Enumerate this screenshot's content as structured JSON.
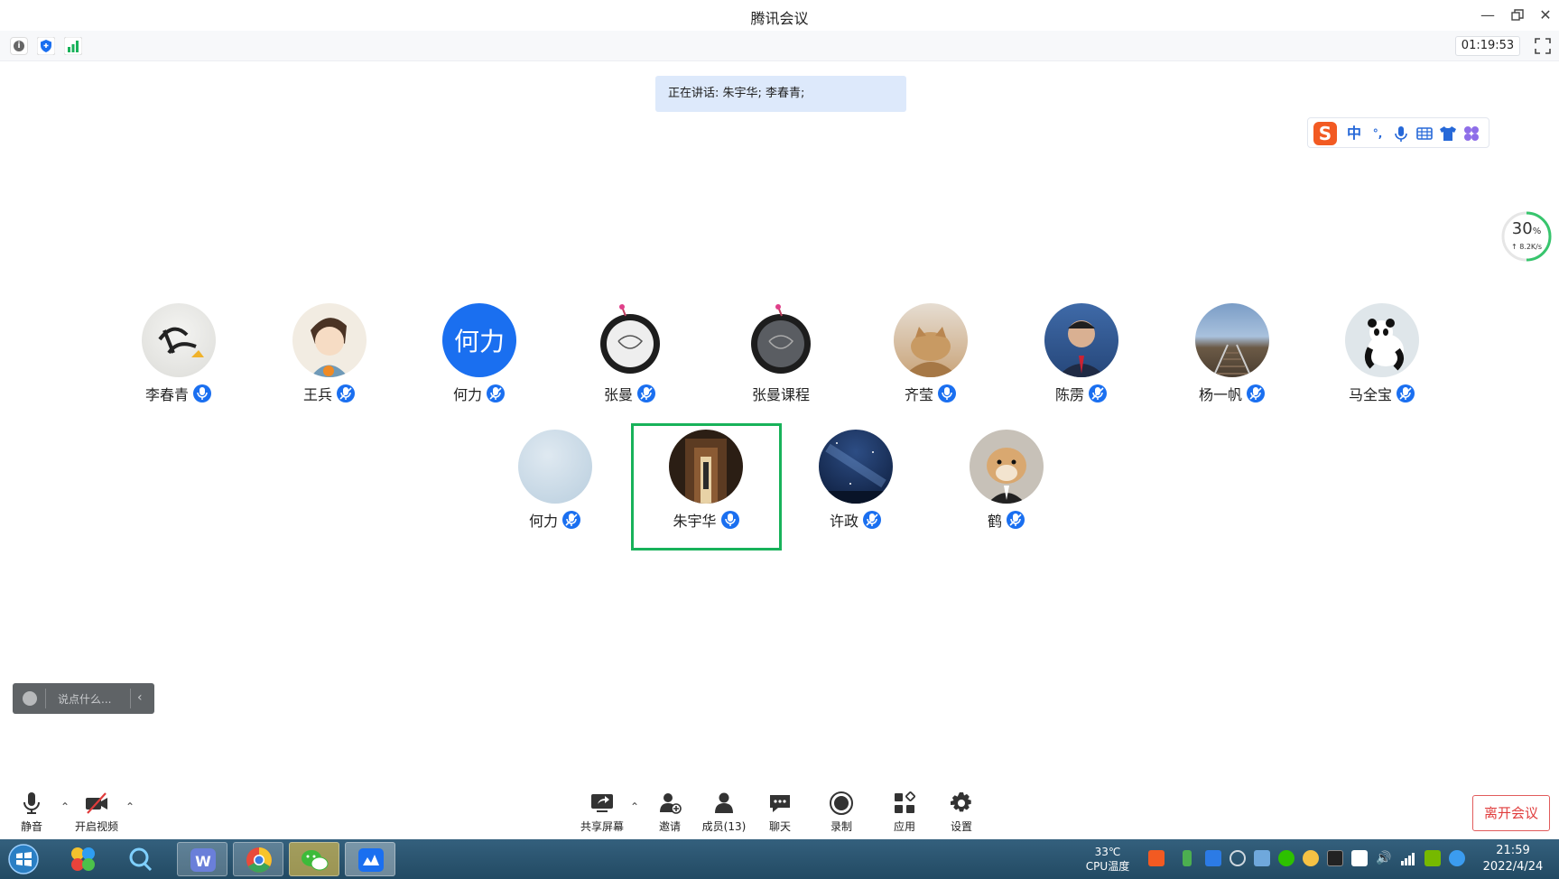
{
  "window": {
    "title": "腾讯会议"
  },
  "toolbar": {
    "timer": "01:19:53"
  },
  "speaking": {
    "text": "正在讲话: 朱宇华; 李春青;"
  },
  "ime": {
    "items": [
      "中",
      "°,"
    ]
  },
  "network": {
    "percent": "30",
    "percent_unit": "%",
    "speed": "↑ 8.2K/s"
  },
  "participants": [
    {
      "name": "李春青",
      "mic_active": true
    },
    {
      "name": "王兵",
      "mic_active": false
    },
    {
      "name": "何力",
      "mic_active": false,
      "avatar_text": "何力"
    },
    {
      "name": "张曼",
      "mic_active": false
    },
    {
      "name": "张曼课程",
      "mic_active": false
    },
    {
      "name": "齐莹",
      "mic_active": true
    },
    {
      "name": "陈雳",
      "mic_active": false
    },
    {
      "name": "杨一帆",
      "mic_active": false
    },
    {
      "name": "马全宝",
      "mic_active": false
    },
    {
      "name": "何力",
      "mic_active": false
    },
    {
      "name": "朱宇华",
      "mic_active": true,
      "highlighted": true
    },
    {
      "name": "许政",
      "mic_active": false
    },
    {
      "name": "鹤",
      "mic_active": false
    }
  ],
  "chat": {
    "placeholder": "说点什么..."
  },
  "controls": {
    "mute": "静音",
    "video": "开启视频",
    "share": "共享屏幕",
    "invite": "邀请",
    "members": "成员(13)",
    "chat": "聊天",
    "record": "录制",
    "apps": "应用",
    "settings": "设置",
    "leave": "离开会议"
  },
  "taskbar": {
    "cpu_temp": "33℃",
    "cpu_label": "CPU温度",
    "time": "21:59",
    "date": "2022/4/24"
  },
  "colors": {
    "accent": "#1a6ff0",
    "speaking_bg": "#dde9fb",
    "active_border": "#18b25a",
    "leave": "#e03c3c"
  }
}
